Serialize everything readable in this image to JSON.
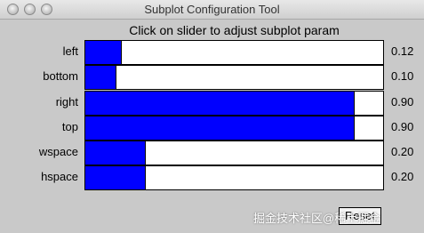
{
  "window": {
    "title": "Subplot Configuration Tool"
  },
  "prompt": "Click on slider to adjust subplot param",
  "sliders": [
    {
      "label": "left",
      "value_text": "0.12",
      "value": 0.12
    },
    {
      "label": "bottom",
      "value_text": "0.10",
      "value": 0.1
    },
    {
      "label": "right",
      "value_text": "0.90",
      "value": 0.9
    },
    {
      "label": "top",
      "value_text": "0.90",
      "value": 0.9
    },
    {
      "label": "wspace",
      "value_text": "0.20",
      "value": 0.2
    },
    {
      "label": "hspace",
      "value_text": "0.20",
      "value": 0.2
    }
  ],
  "reset_label": "Reset",
  "watermark": "掘金技术社区@稀土掘金"
}
